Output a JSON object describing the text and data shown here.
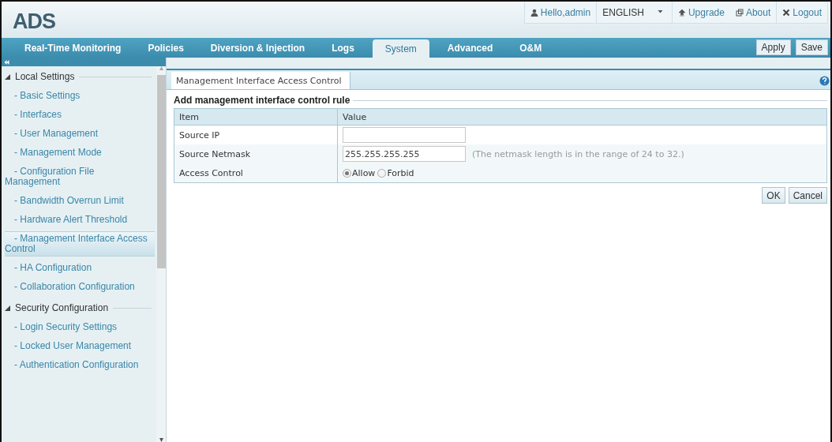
{
  "logo": "ADS",
  "user_bar": {
    "user": "Hello,admin",
    "language": "ENGLISH",
    "links": [
      {
        "kind": "upgrade",
        "label": "Upgrade"
      },
      {
        "kind": "about",
        "label": "About"
      },
      {
        "kind": "logout",
        "label": "Logout"
      }
    ]
  },
  "nav": [
    {
      "label": "Real-Time Monitoring",
      "selected": false
    },
    {
      "label": "Policies",
      "selected": false
    },
    {
      "label": "Diversion & Injection",
      "selected": false
    },
    {
      "label": "Logs",
      "selected": false
    },
    {
      "label": "System",
      "selected": true
    },
    {
      "label": "Advanced",
      "selected": false
    },
    {
      "label": "O&M",
      "selected": false
    }
  ],
  "actions": [
    "Apply",
    "Save"
  ],
  "sidebar": {
    "groups": [
      {
        "title": "Local Settings",
        "expanded": true,
        "items": [
          {
            "label": "- Basic Settings",
            "selected": false
          },
          {
            "label": "- Interfaces",
            "selected": false
          },
          {
            "label": "- User Management",
            "selected": false
          },
          {
            "label": "- Management Mode",
            "selected": false
          },
          {
            "label": "- Configuration File Management",
            "selected": false
          },
          {
            "label": "- Bandwidth Overrun Limit",
            "selected": false
          },
          {
            "label": "- Hardware Alert Threshold",
            "selected": false
          },
          {
            "label": "- Management Interface Access Control",
            "selected": true
          },
          {
            "label": "- HA Configuration",
            "selected": false
          },
          {
            "label": "- Collaboration Configuration",
            "selected": false
          }
        ]
      },
      {
        "title": "Security Configuration",
        "expanded": true,
        "items": [
          {
            "label": "- Login Security Settings",
            "selected": false
          },
          {
            "label": "- Locked User Management",
            "selected": false
          },
          {
            "label": "- Authentication Configuration",
            "selected": false
          }
        ]
      }
    ]
  },
  "panel": {
    "tab": "Management Interface Access Control",
    "section_title": "Add management interface control rule",
    "columns": [
      "Item",
      "Value"
    ],
    "rows": [
      {
        "kind": "field",
        "item": "Source IP"
      },
      {
        "kind": "field",
        "item": "Source Netmask",
        "value": "255.255.255.255",
        "hint": "(The netmask length is in the range of 24 to 32.)"
      },
      {
        "kind": "radio",
        "item": "Access Control",
        "options": [
          {
            "label": "Allow",
            "selected": true
          },
          {
            "label": "Forbid",
            "selected": false
          }
        ]
      }
    ]
  },
  "buttons": [
    "OK",
    "Cancel"
  ]
}
